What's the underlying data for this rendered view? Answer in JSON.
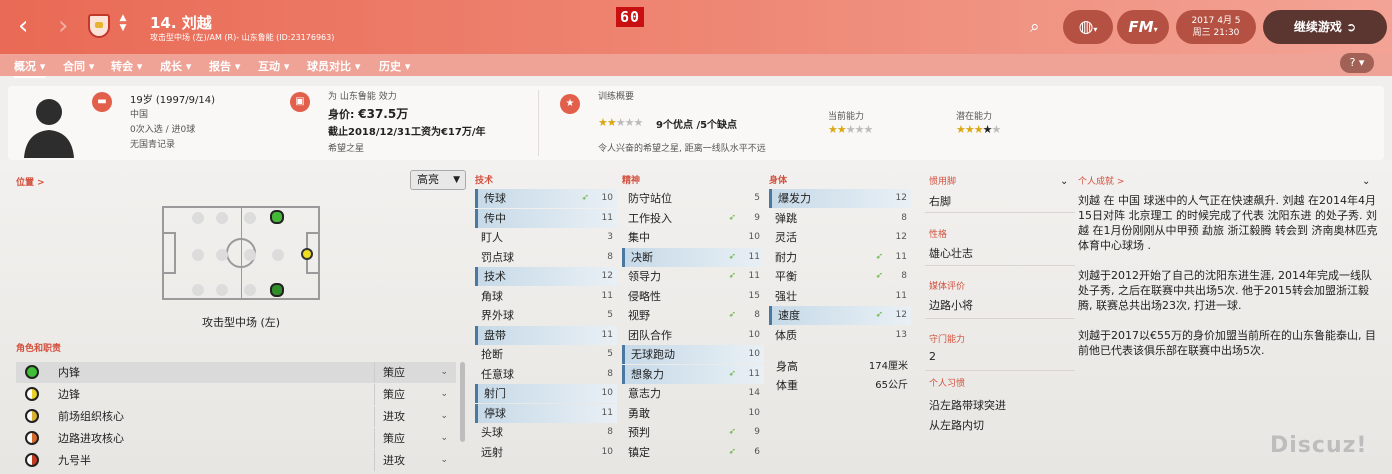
{
  "fps": "60",
  "header": {
    "title": "14. 刘越",
    "subtitle": "攻击型中场 (左)/AM (R)- 山东鲁能 (ID:23176963)",
    "date_line1": "2017 4月 5",
    "date_line2": "周三 21:30",
    "continue_label": "继续游戏",
    "fm_logo": "FM"
  },
  "menu": [
    "概况",
    "合同",
    "转会",
    "成长",
    "报告",
    "互动",
    "球员对比",
    "历史"
  ],
  "info": {
    "age": "19岁 (1997/9/14)",
    "nation": "中国",
    "caps": "0次入选 / 进0球",
    "youth": "无国青记录",
    "club": "为 山东鲁能 效力",
    "value_label": "身价:",
    "value": "€37.5万",
    "contract": "截止2018/12/31工资为€17万/年",
    "status": "希望之星",
    "training_title": "训练概要",
    "training_rating": "9个优点 /5个缺点",
    "training_note": "令人兴奋的希望之星, 距离一线队水平不远",
    "current_ability": "当前能力",
    "potential_ability": "潜在能力",
    "training_stars": 2,
    "current_stars": 2,
    "potential_stars": 3.5
  },
  "left": {
    "position_title": "位置 >",
    "highlight": "高亮",
    "role_label": "攻击型中场 (左)",
    "roles_title": "角色和职责"
  },
  "roles": [
    {
      "name": "内锋",
      "duty": "策应",
      "color": "#3fbf37"
    },
    {
      "name": "边锋",
      "duty": "策应",
      "color": "#e8d12a"
    },
    {
      "name": "前场组织核心",
      "duty": "进攻",
      "color": "#d9b030"
    },
    {
      "name": "边路进攻核心",
      "duty": "策应",
      "color": "#d36a2a"
    },
    {
      "name": "九号半",
      "duty": "进攻",
      "color": "#c23b22"
    }
  ],
  "tech": {
    "title": "技术",
    "rows": [
      [
        "传球",
        "10"
      ],
      [
        "传中",
        "11"
      ],
      [
        "盯人",
        "3"
      ],
      [
        "罚点球",
        "8"
      ],
      [
        "技术",
        "12"
      ],
      [
        "角球",
        "11"
      ],
      [
        "界外球",
        "5"
      ],
      [
        "盘带",
        "11"
      ],
      [
        "抢断",
        "5"
      ],
      [
        "任意球",
        "8"
      ],
      [
        "射门",
        "10"
      ],
      [
        "停球",
        "11"
      ],
      [
        "头球",
        "8"
      ],
      [
        "远射",
        "10"
      ]
    ]
  },
  "mental": {
    "title": "精神",
    "rows": [
      [
        "防守站位",
        "5"
      ],
      [
        "工作投入",
        "9"
      ],
      [
        "集中",
        "10"
      ],
      [
        "决断",
        "11"
      ],
      [
        "领导力",
        "11"
      ],
      [
        "侵略性",
        "15"
      ],
      [
        "视野",
        "8"
      ],
      [
        "团队合作",
        "10"
      ],
      [
        "无球跑动",
        "10"
      ],
      [
        "想象力",
        "11"
      ],
      [
        "意志力",
        "14"
      ],
      [
        "勇敢",
        "10"
      ],
      [
        "预判",
        "9"
      ],
      [
        "镇定",
        "6"
      ]
    ]
  },
  "physical": {
    "title": "身体",
    "rows": [
      [
        "爆发力",
        "12"
      ],
      [
        "弹跳",
        "8"
      ],
      [
        "灵活",
        "12"
      ],
      [
        "耐力",
        "11"
      ],
      [
        "平衡",
        "8"
      ],
      [
        "强壮",
        "11"
      ],
      [
        "速度",
        "12"
      ],
      [
        "体质",
        "13"
      ]
    ],
    "height_label": "身高",
    "height": "174厘米",
    "weight_label": "体重",
    "weight": "65公斤"
  },
  "right": {
    "foot_title": "惯用脚",
    "foot": "右脚",
    "pers_title": "性格",
    "pers": "雄心壮志",
    "media_title": "媒体评价",
    "media": "边路小将",
    "def_title": "守门能力",
    "def": "2",
    "habits_title": "个人习惯",
    "habits": [
      "沿左路带球突进",
      "从左路内切"
    ]
  },
  "bio": {
    "title": "个人成就 >",
    "p1": "刘越 在 中国 球迷中的人气正在快速飙升. 刘越 在2014年4月15日对阵 北京理工 的时候完成了代表 沈阳东进 的处子秀. 刘越 在1月份刚刚从中甲预 勐旅 浙江毅腾 转会到 济南奥林匹克体育中心球场 .",
    "p2": "刘越于2012开始了自己的沈阳东进生涯, 2014年完成一线队处子秀, 之后在联赛中共出场5次. 他于2015转会加盟浙江毅腾, 联赛总共出场23次, 打进一球.",
    "p3": "刘越于2017以€55万的身价加盟当前所在的山东鲁能泰山, 目前他已代表该俱乐部在联赛中出场5次."
  },
  "watermark": "Discuz!"
}
